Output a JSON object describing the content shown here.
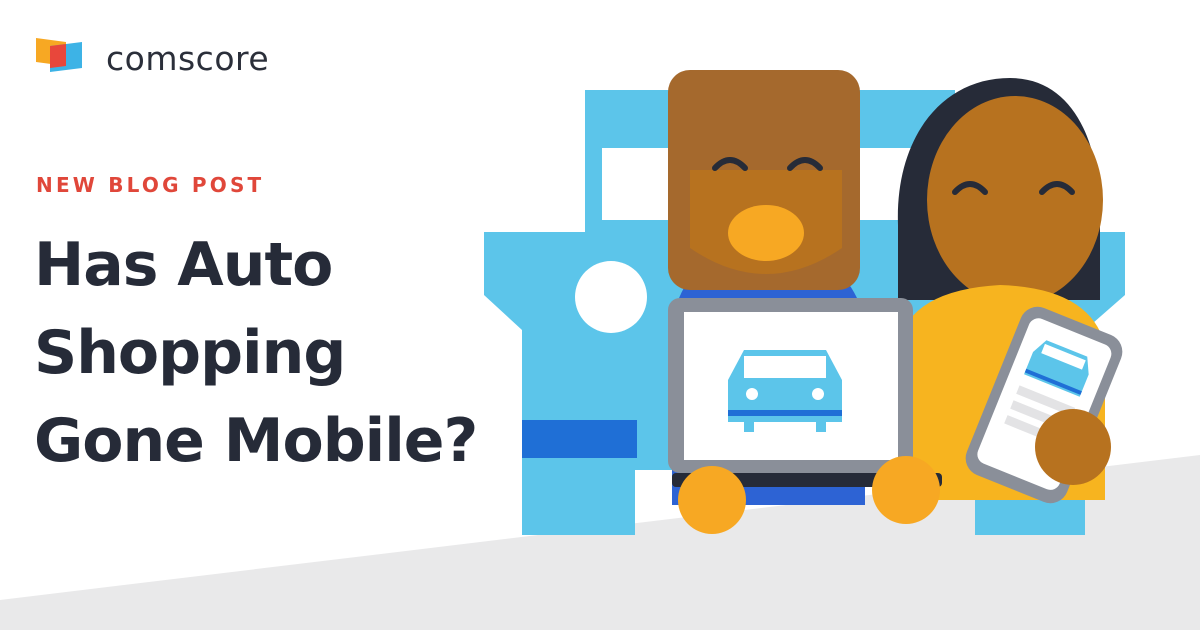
{
  "brand": {
    "name": "comscore",
    "colors": {
      "orange": "#f7a823",
      "red": "#e8473b",
      "blue": "#3db3e6"
    }
  },
  "post": {
    "kicker": "NEW BLOG POST",
    "title_lines": [
      "Has Auto",
      "Shopping",
      "Gone Mobile?"
    ]
  },
  "illustration": {
    "elements": [
      "car-icon",
      "man-figure",
      "woman-figure",
      "laptop-icon",
      "smartphone-icon"
    ]
  }
}
